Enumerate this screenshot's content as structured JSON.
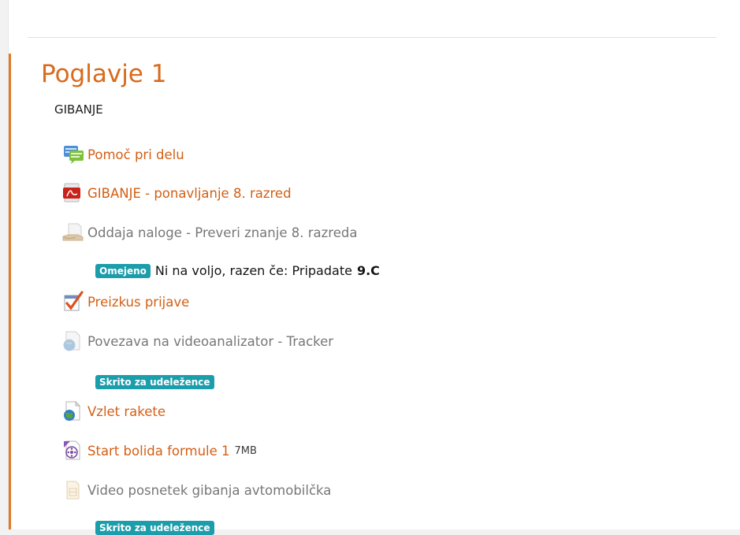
{
  "section": {
    "title": "Poglavje 1",
    "summary": "GIBANJE"
  },
  "activities": [
    {
      "name": "Pomoč pri delu",
      "icon": "forum-icon",
      "state": "link"
    },
    {
      "name": "GIBANJE - ponavljanje 8. razred",
      "icon": "pdf-icon",
      "state": "link"
    },
    {
      "name": "Oddaja naloge - Preveri znanje 8. razreda",
      "icon": "assignment-icon",
      "state": "dimmed",
      "restriction": {
        "badge": "Omejeno",
        "text": "Ni na voljo, razen če: Pripadate",
        "group": "9.C"
      }
    },
    {
      "name": "Preizkus prijave",
      "icon": "quiz-icon",
      "state": "link"
    },
    {
      "name": "Povezava na videoanalizator - Tracker",
      "icon": "url-icon",
      "state": "dimmed",
      "badge": "Skrito za udeležence"
    },
    {
      "name": "Vzlet rakete",
      "icon": "url-icon",
      "state": "link"
    },
    {
      "name": "Start bolida formule 1",
      "icon": "video-file-icon",
      "state": "link",
      "size": "7MB"
    },
    {
      "name": "Video posnetek gibanja avtomobilčka",
      "icon": "folder-file-icon",
      "state": "dimmed",
      "badge": "Skrito za udeležence"
    }
  ],
  "colors": {
    "accent": "#e07a28",
    "link": "#d35f14",
    "badge": "#1c9dab"
  }
}
